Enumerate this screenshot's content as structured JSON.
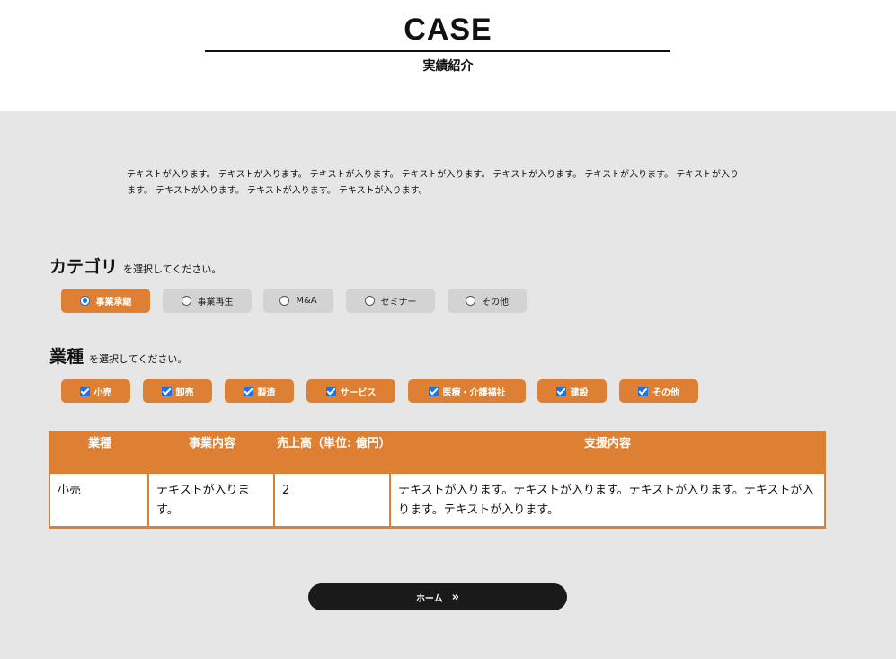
{
  "header": {
    "title": "CASE",
    "subtitle": "実績紹介"
  },
  "intro": {
    "text": "テキストが入ります。 テキストが入ります。 テキストが入ります。 テキストが入ります。 テキストが入ります。 テキストが入ります。 テキストが入ります。 テキストが入ります。 テキストが入ります。 テキストが入ります。"
  },
  "category": {
    "label": "カテゴリ",
    "hint": "を選択してください。",
    "options": [
      "事業承継",
      "事業再生",
      "M&A",
      "セミナー",
      "その他"
    ],
    "selected": "事業承継"
  },
  "industry": {
    "label": "業種",
    "hint": "を選択してください。",
    "options": [
      "小売",
      "卸売",
      "製造",
      "サービス",
      "医療・介護福祉",
      "建設",
      "その他"
    ]
  },
  "table": {
    "headers": [
      "業種",
      "事業内容",
      "売上高（単位: 億円）",
      "支援内容"
    ],
    "rows": [
      [
        "小売",
        "テキストが入ります。",
        "2",
        "テキストが入ります。テキストが入ります。テキストが入ります。テキストが入ります。テキストが入ります。"
      ]
    ]
  },
  "footer": {
    "home_label": "ホーム",
    "home_icon": "double-chevron-right-icon"
  },
  "colors": {
    "accent": "#dd8033",
    "background": "#e6e6e6",
    "button": "#1a1a1a",
    "check": "#1a73e8"
  }
}
